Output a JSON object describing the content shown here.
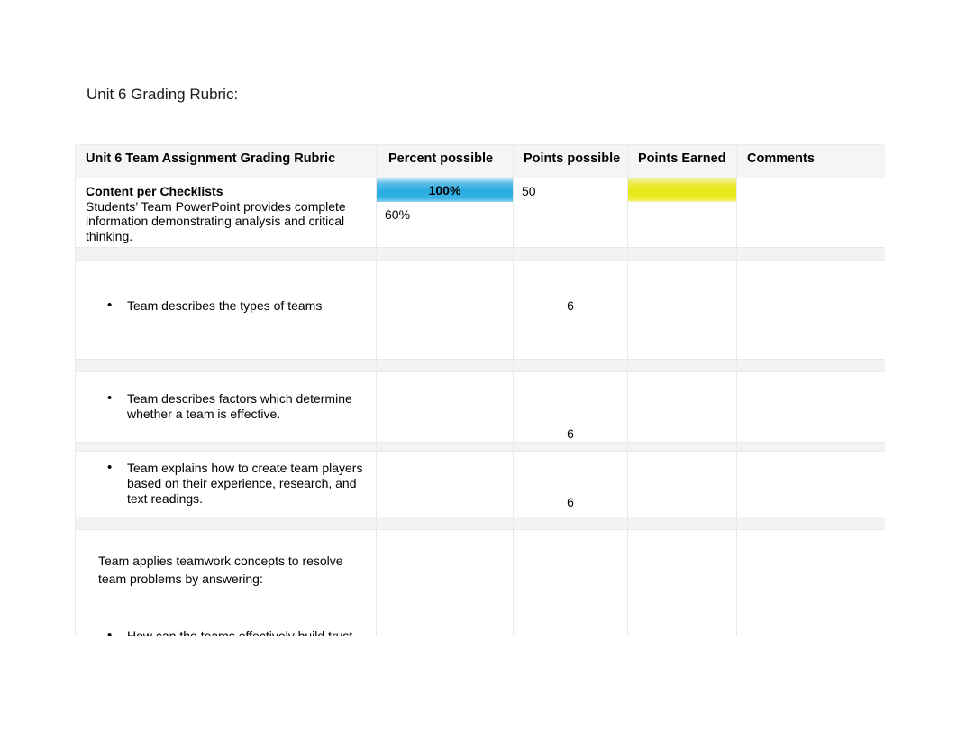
{
  "document": {
    "title": "Unit 6 Grading Rubric:"
  },
  "table": {
    "columns": [
      "Unit 6 Team Assignment Grading Rubric",
      "Percent possible",
      "Points possible",
      "Points Earned",
      "Comments"
    ],
    "colors": {
      "percent_highlight": "#29abe2",
      "earned_highlight": "#e8e815",
      "header_background": "#f5f5f5",
      "border": "#e8e8e8"
    },
    "rows": [
      {
        "criteria_heading": "Content per Checklists",
        "criteria_text": "Students’ Team PowerPoint provides complete information demonstrating analysis and critical thinking.",
        "percent_possible": "100%",
        "percent_possible_secondary": "60%",
        "points_possible": "50",
        "points_earned": "",
        "comments": "",
        "percent_highlighted": true,
        "earned_highlighted": true
      },
      {
        "bullet": "Team describes  the types of teams",
        "percent_possible": "",
        "points_possible": "6",
        "points_earned": "",
        "comments": ""
      },
      {
        "bullet": "Team describes factors which determine whether a team is effective.",
        "percent_possible": "",
        "points_possible": "6",
        "points_earned": "",
        "comments": ""
      },
      {
        "bullet": "Team explains how to create team players based on their experience, research, and text readings.",
        "percent_possible": "",
        "points_possible": "6",
        "points_earned": "",
        "comments": ""
      },
      {
        "criteria_text": "Team applies teamwork concepts to resolve team problems by answering:",
        "bullet": "How can the teams effectively build trust amongst team members?",
        "percent_possible": "",
        "points_possible": "",
        "points_earned": "",
        "comments": ""
      }
    ]
  }
}
